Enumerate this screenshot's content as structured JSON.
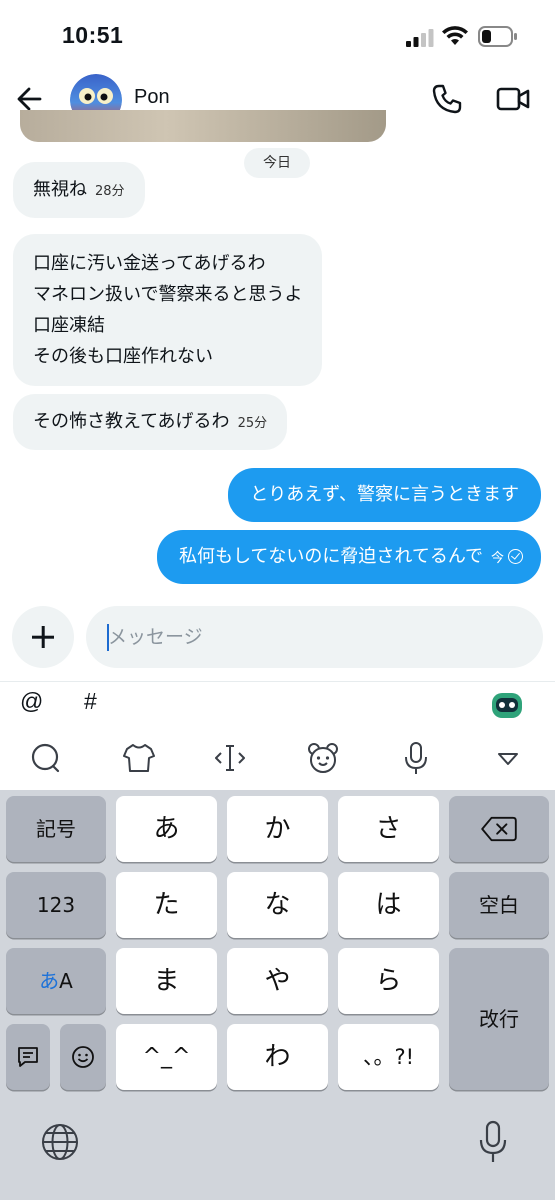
{
  "status_bar": {
    "time": "10:51"
  },
  "header": {
    "contact_name": "Pon"
  },
  "chat": {
    "date_separator": "今日",
    "messages": [
      {
        "direction": "in",
        "lines": [
          "無視ね"
        ],
        "time": "28分"
      },
      {
        "direction": "in",
        "lines": [
          "口座に汚い金送ってあげるわ",
          "マネロン扱いで警察来ると思うよ",
          "口座凍結",
          "その後も口座作れない"
        ],
        "time": ""
      },
      {
        "direction": "in",
        "lines": [
          "その怖さ教えてあげるわ"
        ],
        "time": "25分"
      },
      {
        "direction": "out",
        "lines": [
          "とりあえず、警察に言うときます"
        ],
        "time": ""
      },
      {
        "direction": "out",
        "lines": [
          "私何もしてないのに脅迫されてるんで"
        ],
        "time": "今"
      }
    ]
  },
  "composer": {
    "placeholder": "メッセージ"
  },
  "keyboard": {
    "suggestion_symbols": [
      "@",
      "#"
    ],
    "toolbar_icons": [
      "search-bubble-icon",
      "shirt-icon",
      "cursor-move-icon",
      "bear-face-icon",
      "microphone-icon",
      "collapse-triangle-icon"
    ],
    "rows": [
      [
        "記号",
        "あ",
        "か",
        "さ",
        "⌫"
      ],
      [
        "123",
        "た",
        "な",
        "は",
        "空白"
      ],
      [
        "あA",
        "ま",
        "や",
        "ら",
        "改行"
      ],
      [
        "",
        "",
        "^_^",
        "わ",
        "、。?!"
      ]
    ],
    "mode_key": {
      "kana": "あ",
      "latin": "A"
    },
    "accent_color": "#1d9bf0"
  }
}
